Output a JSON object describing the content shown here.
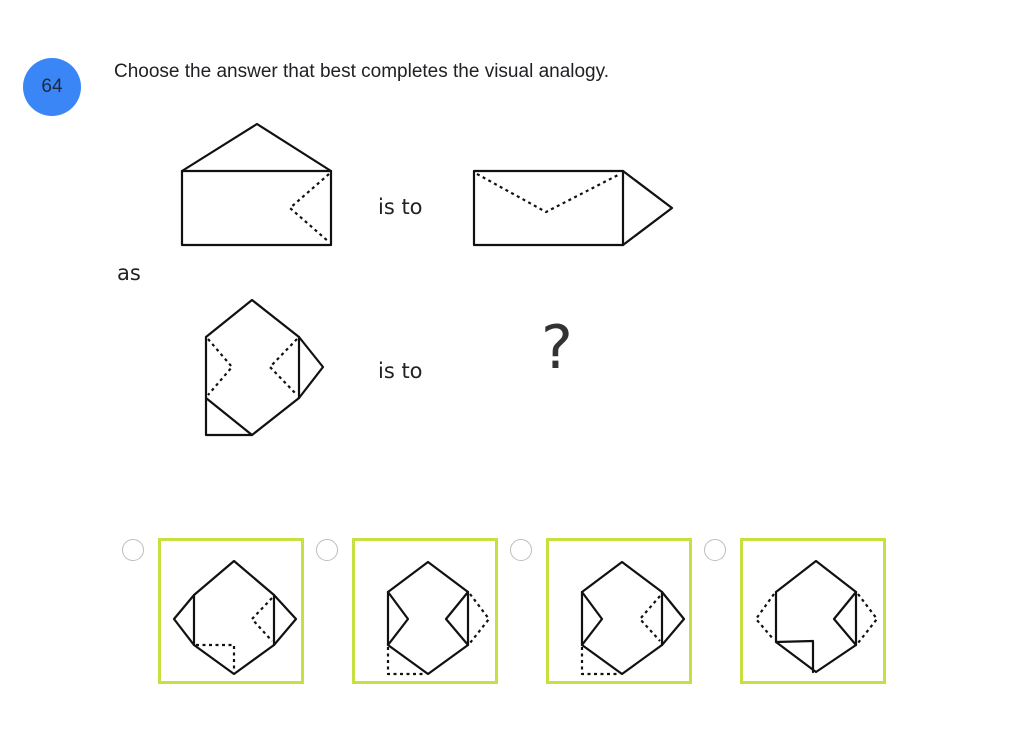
{
  "question": {
    "number": "64",
    "prompt": "Choose the answer that best completes the visual analogy.",
    "number_badge_color": "#3b86f7"
  },
  "analogy": {
    "row1": {
      "left_figure": "envelope-flap-up-dotted-right-fold",
      "connector": "is to",
      "right_figure": "envelope-flap-right-dotted-top-fold"
    },
    "joiner": "as",
    "row2": {
      "left_figure": "folded-hexagon-with-dotted-side-folds-and-flap-bottom-left",
      "connector": "is to",
      "unknown": "?"
    }
  },
  "options": [
    {
      "id": "A",
      "selected": false,
      "figure": "option-a-figure"
    },
    {
      "id": "B",
      "selected": false,
      "figure": "option-b-figure"
    },
    {
      "id": "C",
      "selected": false,
      "figure": "option-c-figure"
    },
    {
      "id": "D",
      "selected": false,
      "figure": "option-d-figure"
    }
  ],
  "colors": {
    "option_border": "#c6e03f",
    "radio_border": "#bdbdbd"
  }
}
